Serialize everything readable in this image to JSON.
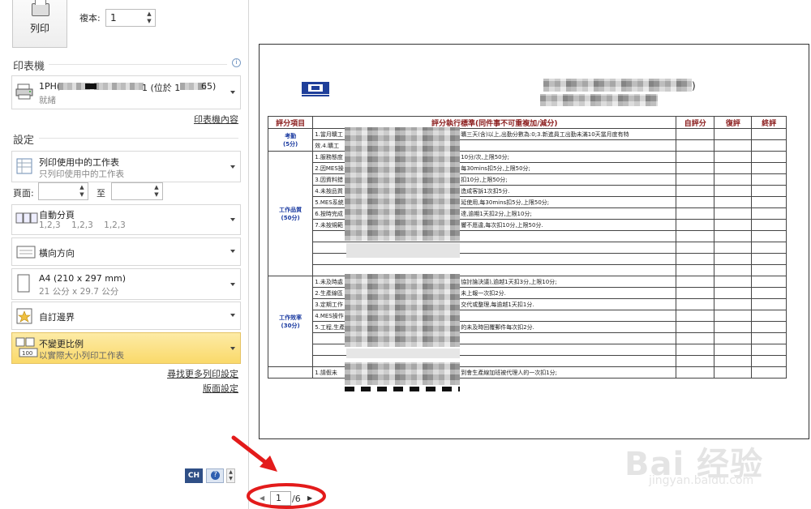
{
  "print_button": {
    "label": "列印"
  },
  "copies": {
    "label": "複本:",
    "value": "1"
  },
  "printer": {
    "section_title": "印表機",
    "name_prefix": "1PH(",
    "name_middle": "1 (位於 1",
    "name_suffix": "65)",
    "status": "就緒",
    "properties_link": "印表機內容"
  },
  "settings": {
    "section_title": "設定",
    "scope": {
      "title": "列印使用中的工作表",
      "subtitle": "只列印使用中的工作表"
    },
    "pages": {
      "label": "頁面:",
      "to_label": "至"
    },
    "collate": {
      "title": "自動分頁",
      "subtitle": "1,2,3    1,2,3    1,2,3"
    },
    "orientation": {
      "title": "橫向方向"
    },
    "paper": {
      "title": "A4 (210 x 297 mm)",
      "subtitle": "21 公分 x 29.7 公分"
    },
    "margins": {
      "title": "自訂邊界"
    },
    "scaling": {
      "title": "不變更比例",
      "subtitle": "以實際大小列印工作表"
    },
    "more_settings_link": "尋找更多列印設定",
    "page_setup_link": "版面設定"
  },
  "status_bar": {
    "lang": "CH",
    "help": "?"
  },
  "preview": {
    "current_page": "1",
    "total_pages": "/6",
    "table_headers": [
      "評分項目",
      "評分執行標準(同件事不可重複加/減分)",
      "自評分",
      "復評",
      "終評"
    ],
    "categories": [
      {
        "name": "考勤",
        "score": "(5分)"
      },
      {
        "name": "工作品質",
        "score": "(50分)"
      },
      {
        "name": "工作效率",
        "score": "(30分)"
      }
    ],
    "rows_attendance": [
      "1.當月曠工",
      "效.4.曠工"
    ],
    "rows_attendance_right": [
      "曠三天(含)以上,出勤分數為:0;3.新進員工出勤未滿10天當月度有特",
      ""
    ],
    "rows_quality": [
      "1.服務態度",
      "2.因MES操",
      "3.因資料錯",
      "4.未按品質",
      "5.MES系統",
      "6.按時完成",
      "7.未按規範"
    ],
    "rows_quality_right": [
      "10分/次,上限50分;",
      "每30mins扣5分,上限50分;",
      "扣10分,上限50分;",
      "造成客訴1次扣5分.",
      "延使用,每30mins扣5分,上限50分;",
      "達,逾期1天扣2分,上限10分;",
      "響不愿違,每次扣10分,上限50分."
    ],
    "rows_efficiency": [
      "1.未及時處",
      "2.生產線區",
      "3.定期工作",
      "4.MES操作",
      "5.工程,生產"
    ],
    "rows_efficiency_right": [
      "協討論決議),逾越1天扣3分,上限10分;",
      "未上報一次扣2分.",
      "交代或整理,每逾越1天扣1分.",
      "",
      "的未及時回覆郵件每次扣2分."
    ],
    "rows_last": [
      "1.請假未",
      "到會生產線加班被代理人的一次扣1分;"
    ]
  },
  "watermark": {
    "brand": "Bai 经验",
    "url": "jingyan.baidu.com"
  }
}
